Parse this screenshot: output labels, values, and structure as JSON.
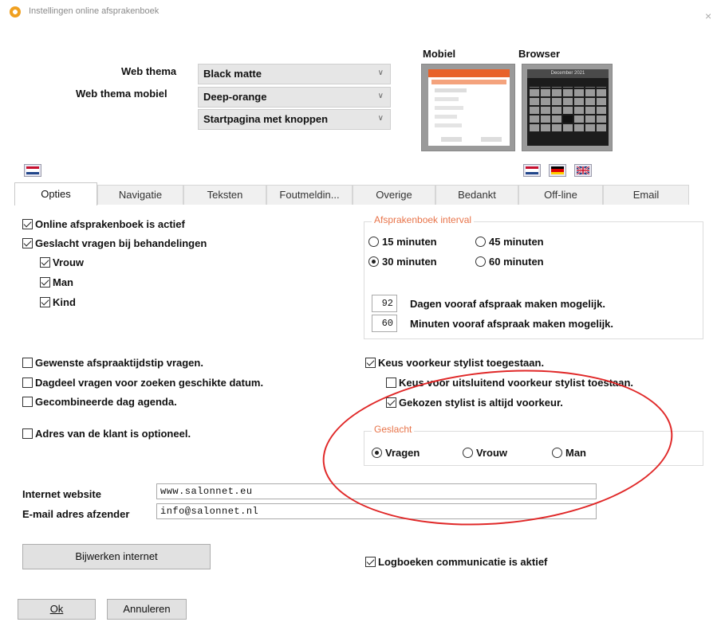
{
  "window": {
    "title": "Instellingen online afsprakenboek",
    "close": "×"
  },
  "theme": {
    "web_theme_label": "Web thema",
    "web_theme_mobile_label": "Web thema mobiel",
    "web_theme_value": "Black matte",
    "web_theme_mobile_value": "Deep-orange",
    "start_page_value": "Startpagina met knoppen"
  },
  "preview": {
    "mobile_label": "Mobiel",
    "browser_label": "Browser",
    "browser_header": "December 2021"
  },
  "tabs": [
    "Opties",
    "Navigatie",
    "Teksten",
    "Foutmeldin...",
    "Overige",
    "Bedankt",
    "Off-line",
    "Email"
  ],
  "options": {
    "active": "Online afsprakenboek is actief",
    "gender_ask": "Geslacht vragen bij behandelingen",
    "woman": "Vrouw",
    "man": "Man",
    "child": "Kind",
    "desired_time": "Gewenste afspraaktijdstip vragen.",
    "day_part": "Dagdeel vragen voor zoeken geschikte datum.",
    "combined_agenda": "Gecombineerde dag agenda.",
    "address_optional": "Adres van de klant is optioneel."
  },
  "interval": {
    "title": "Afsprakenboek interval",
    "m15": "15 minuten",
    "m45": "45 minuten",
    "m30": "30 minuten",
    "m60": "60 minuten",
    "days_value": "92",
    "days_label": "Dagen vooraf afspraak maken mogelijk.",
    "minutes_value": "60",
    "minutes_label": "Minuten vooraf afspraak maken mogelijk."
  },
  "stylist": {
    "pref_allowed": "Keus voorkeur stylist toegestaan.",
    "exclusive_pref": "Keus voor uitsluitend voorkeur stylist toestaan.",
    "always_pref": "Gekozen stylist is altijd voorkeur."
  },
  "gender_group": {
    "title": "Geslacht",
    "ask": "Vragen",
    "woman": "Vrouw",
    "man": "Man"
  },
  "internet": {
    "website_label": "Internet website",
    "website_value": "www.salonnet.eu",
    "email_label": "E-mail adres afzender",
    "email_value": "info@salonnet.nl",
    "update_button": "Bijwerken internet",
    "logbook": "Logboeken communicatie is aktief"
  },
  "footer": {
    "ok": "Ok",
    "cancel": "Annuleren"
  },
  "colors": {
    "accent": "#e8744a",
    "annotation": "#e02828"
  }
}
